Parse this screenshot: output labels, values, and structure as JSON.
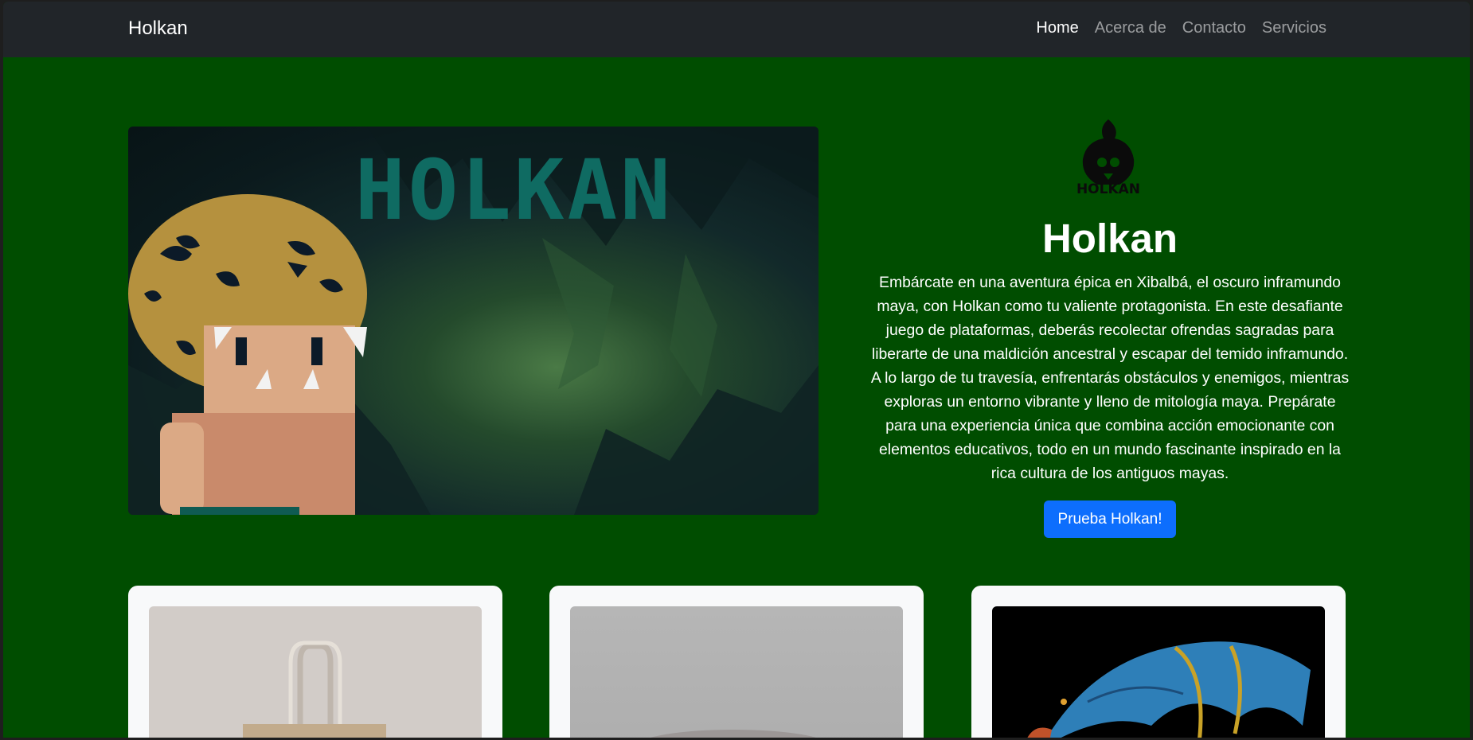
{
  "nav": {
    "brand": "Holkan",
    "links": [
      {
        "label": "Home",
        "active": true
      },
      {
        "label": "Acerca de",
        "active": false
      },
      {
        "label": "Contacto",
        "active": false
      },
      {
        "label": "Servicios",
        "active": false
      }
    ]
  },
  "hero": {
    "image_text": "HOLKAN",
    "logo_text": "HOLKAN",
    "title": "Holkan",
    "description": "Embárcate en una aventura épica en Xibalbá, el oscuro inframundo maya, con Holkan como tu valiente protagonista. En este desafiante juego de plataformas, deberás recolectar ofrendas sagradas para liberarte de una maldición ancestral y escapar del temido inframundo. A lo largo de tu travesía, enfrentarás obstáculos y enemigos, mientras exploras un entorno vibrante y lleno de mitología maya. Prepárate para una experiencia única que combina acción emocionante con elementos educativos, todo en un mundo fascinante inspirado en la rica cultura de los antiguos mayas.",
    "cta_label": "Prueba Holkan!"
  },
  "cards": [
    {
      "image": "tote-bag-photo"
    },
    {
      "image": "product-photo-gray"
    },
    {
      "image": "alebrije-dragon-photo"
    }
  ],
  "colors": {
    "page_bg": "#004d00",
    "navbar_bg": "#212529",
    "cta_bg": "#0d6efd",
    "card_bg": "#f8f9fa"
  }
}
